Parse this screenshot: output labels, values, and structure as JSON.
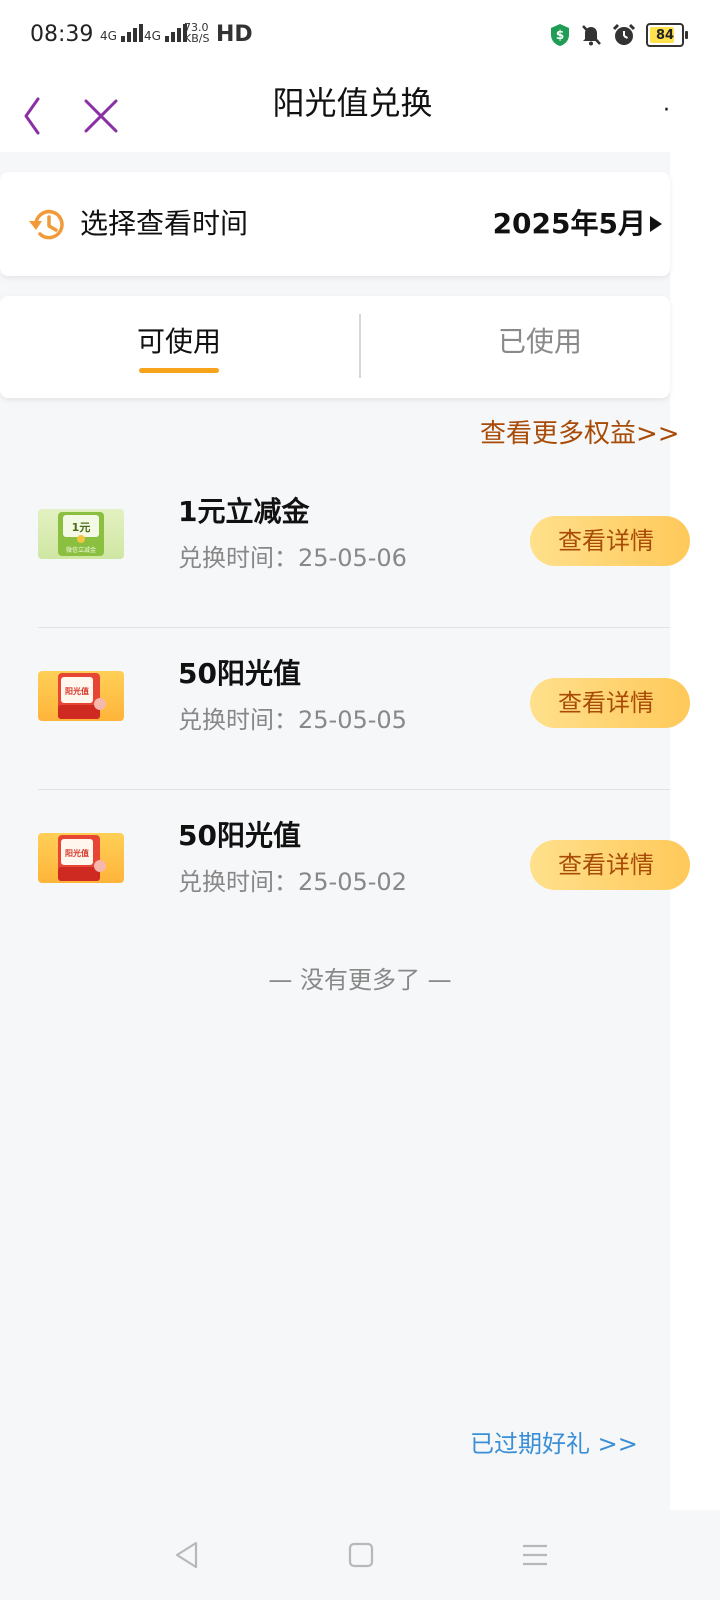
{
  "status_bar": {
    "time": "08:39",
    "net1": "4G",
    "net2": "4G",
    "speed_value": "73.0",
    "speed_unit": "KB/S",
    "hd": "HD",
    "battery": "84"
  },
  "header": {
    "title": "阳光值兑换"
  },
  "time_selector": {
    "label": "选择查看时间",
    "value": "2025年5月"
  },
  "tabs": [
    {
      "label": "可使用",
      "active": true
    },
    {
      "label": "已使用",
      "active": false
    }
  ],
  "more_rights_link": "查看更多权益>>",
  "items": [
    {
      "name": "1元立减金",
      "date": "兑换时间：25-05-06",
      "button": "查看详情",
      "thumb_text": "1元",
      "thumb_sub": "微信立减金",
      "thumb": "green-envelope-icon"
    },
    {
      "name": "50阳光值",
      "date": "兑换时间：25-05-05",
      "button": "查看详情",
      "thumb_text": "阳光值",
      "thumb": "orange-envelope-icon"
    },
    {
      "name": "50阳光值",
      "date": "兑换时间：25-05-02",
      "button": "查看详情",
      "thumb_text": "阳光值",
      "thumb": "orange-envelope-icon"
    }
  ],
  "no_more_text": "— 没有更多了 —",
  "expired_link": "已过期好礼 >>",
  "colors": {
    "accent_orange": "#f7a31c",
    "link_brown": "#a84b07",
    "link_blue": "#3a8fd6",
    "brand_purple": "#7a2b9b"
  }
}
